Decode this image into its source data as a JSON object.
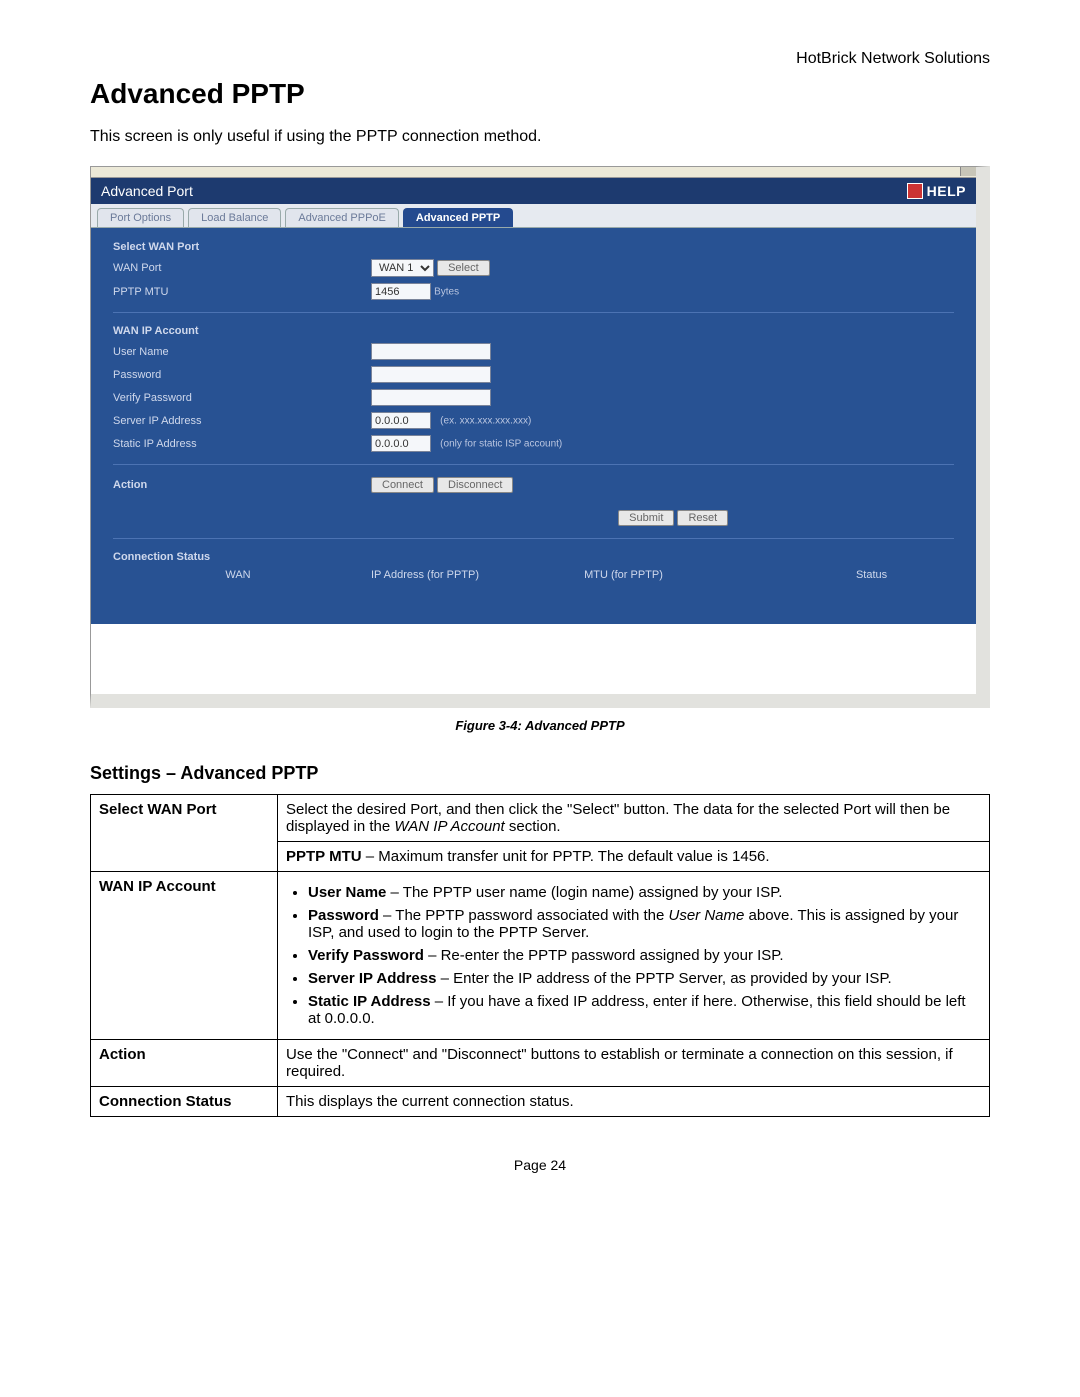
{
  "header_right": "HotBrick Network Solutions",
  "title": "Advanced PPTP",
  "intro": "This screen is only useful if using the PPTP connection method.",
  "shot": {
    "banner_title": "Advanced Port",
    "help_label": "HELP",
    "tabs": [
      "Port Options",
      "Load Balance",
      "Advanced PPPoE",
      "Advanced PPTP"
    ],
    "sections": {
      "select_wan_port": "Select WAN Port",
      "wan_ip_account": "WAN IP Account",
      "action": "Action",
      "connection_status": "Connection Status"
    },
    "rows": {
      "wan_port": "WAN Port",
      "pptp_mtu": "PPTP MTU",
      "user_name": "User Name",
      "password": "Password",
      "verify_password": "Verify Password",
      "server_ip": "Server IP Address",
      "static_ip": "Static IP Address"
    },
    "values": {
      "wan_port_select": "WAN 1",
      "pptp_mtu": "1456",
      "pptp_mtu_unit": "Bytes",
      "server_ip": "0.0.0.0",
      "server_ip_hint": "(ex. xxx.xxx.xxx.xxx)",
      "static_ip": "0.0.0.0",
      "static_ip_hint": "(only for static ISP account)"
    },
    "buttons": {
      "select": "Select",
      "connect": "Connect",
      "disconnect": "Disconnect",
      "submit": "Submit",
      "reset": "Reset"
    },
    "status_cols": {
      "wan": "WAN",
      "ip": "IP Address (for PPTP)",
      "mtu": "MTU (for PPTP)",
      "status": "Status"
    }
  },
  "caption": "Figure 3-4: Advanced PPTP",
  "settings_heading": "Settings – Advanced PPTP",
  "table": {
    "r1_label": "Select WAN Port",
    "r1_a": "Select the desired Port, and then click the \"Select\" button. The data for the selected Port will then be displayed in the ",
    "r1_a_em": "WAN IP Account",
    "r1_a_end": " section.",
    "r1_b_strong": "PPTP MTU",
    "r1_b": " – Maximum transfer unit for PPTP. The default value is 1456.",
    "r2_label": "WAN IP Account",
    "r2_user_strong": "User Name",
    "r2_user": " – The PPTP user name (login name) assigned by your ISP.",
    "r2_pass_strong": "Password",
    "r2_pass_a": " – The PPTP password associated with the ",
    "r2_pass_em": "User Name",
    "r2_pass_b": " above. This is assigned by your ISP, and used to login to the PPTP Server.",
    "r2_verify_strong": "Verify Password",
    "r2_verify": " – Re-enter the PPTP password assigned by your ISP.",
    "r2_server_strong": "Server IP Address",
    "r2_server": " – Enter the IP address of the PPTP Server, as provided by your ISP.",
    "r2_static_strong": "Static IP Address",
    "r2_static": " – If you have a fixed IP address, enter if here. Otherwise, this field should be left at 0.0.0.0.",
    "r3_label": "Action",
    "r3": "Use the \"Connect\" and \"Disconnect\" buttons to establish or terminate a connection on this session, if required.",
    "r4_label": "Connection Status",
    "r4": "This displays the current connection status."
  },
  "footer": "Page 24"
}
